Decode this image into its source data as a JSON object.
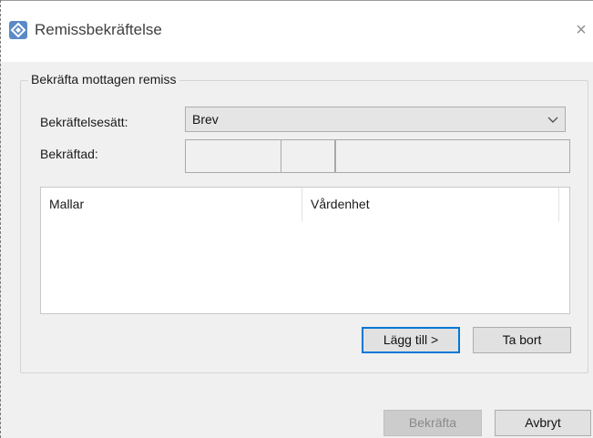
{
  "window": {
    "title": "Remissbekräftelse",
    "close_glyph": "×",
    "icon": "app-diamond-icon"
  },
  "group": {
    "legend": "Bekräfta mottagen remiss"
  },
  "form": {
    "method_label": "Bekräftelsesätt:",
    "method_value": "Brev",
    "confirmed_label": "Bekräftad:",
    "confirmed_date_parts": [
      "",
      "",
      ""
    ]
  },
  "list": {
    "columns": [
      "Mallar",
      "Vårdenhet"
    ],
    "rows": []
  },
  "buttons": {
    "add": "Lägg till >",
    "remove": "Ta bort",
    "confirm": "Bekräfta",
    "cancel": "Avbryt"
  },
  "colors": {
    "focus_border": "#0078d7",
    "app_icon": "#5b8ac7"
  }
}
